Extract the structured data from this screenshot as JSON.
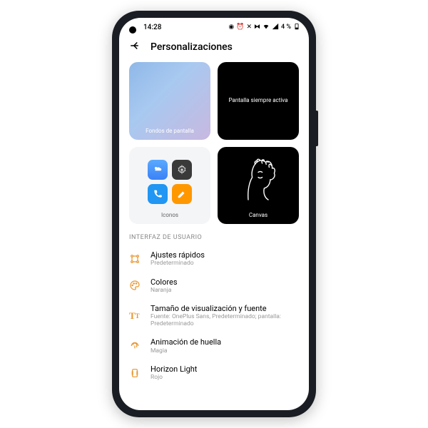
{
  "status": {
    "time": "14:28",
    "battery": "4 %"
  },
  "header": {
    "title": "Personalizaciones"
  },
  "cards": {
    "wallpaper": "Fondos de pantalla",
    "aod": "Pantalla siempre activa",
    "icons": "Iconos",
    "canvas": "Canvas"
  },
  "section": {
    "ui": "INTERFAZ DE USUARIO"
  },
  "list": [
    {
      "title": "Ajustes rápidos",
      "sub": "Predeterminado",
      "icon": "quick-settings"
    },
    {
      "title": "Colores",
      "sub": "Naranja",
      "icon": "palette"
    },
    {
      "title": "Tamaño de visualización y fuente",
      "sub": "Fuente: OnePlus Sans, Predeterminado; pantalla: Predeterminado",
      "icon": "font"
    },
    {
      "title": "Animación de huella",
      "sub": "Magia",
      "icon": "fingerprint"
    },
    {
      "title": "Horizon Light",
      "sub": "Rojo",
      "icon": "horizon"
    }
  ],
  "colors": {
    "accent": "#e8952e"
  }
}
